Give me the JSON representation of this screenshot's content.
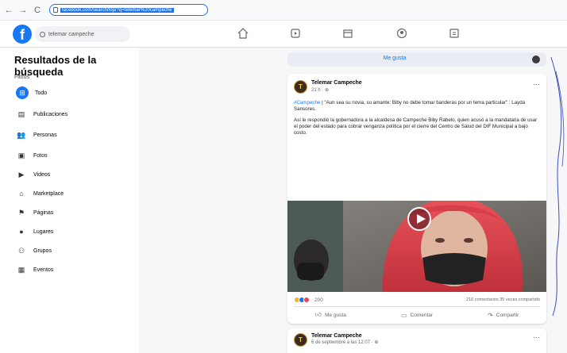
{
  "browser": {
    "url": "facebook.com/search/top/?q=telemar%20campeche"
  },
  "header": {
    "logo": "f",
    "search_value": "telemar campeche"
  },
  "sidebar": {
    "title": "Resultados de la búsqueda",
    "filters_label": "Filtros",
    "items": [
      {
        "label": "Todo",
        "icon": "grid-icon",
        "glyph": "⊞",
        "active": true
      },
      {
        "label": "Publicaciones",
        "icon": "post-icon",
        "glyph": "▤"
      },
      {
        "label": "Personas",
        "icon": "people-icon",
        "glyph": "👥"
      },
      {
        "label": "Fotos",
        "icon": "photo-icon",
        "glyph": "▣"
      },
      {
        "label": "Videos",
        "icon": "video-icon",
        "glyph": "▶"
      },
      {
        "label": "Marketplace",
        "icon": "marketplace-icon",
        "glyph": "⌂"
      },
      {
        "label": "Páginas",
        "icon": "flag-icon",
        "glyph": "⚑"
      },
      {
        "label": "Lugares",
        "icon": "location-icon",
        "glyph": "●"
      },
      {
        "label": "Grupos",
        "icon": "groups-icon",
        "glyph": "⚇"
      },
      {
        "label": "Eventos",
        "icon": "calendar-icon",
        "glyph": "▦"
      }
    ]
  },
  "feed": {
    "page_like_label": "Me gusta",
    "post": {
      "author": "Telemar Campeche",
      "time": "21 h · ⊕",
      "hashtag": "#Campeche",
      "line1": " | \"Aun sea su novia, su amante: Biby no debe tomar banderas por un tema particular\" : Layda Sansores.",
      "line2": "Así le respondió la gobernadora a la alcaldesa de Campeche Biby Rabelo, quien acusó a la mandataria de usar el poder del estado para cobrar venganza política por el cierre del Centro de Salud del DIF Municipal a bajo costo.",
      "reaction_count": "200",
      "stats": "216 comentarios  35 veces compartido",
      "actions": {
        "like": "Me gusta",
        "comment": "Comentar",
        "share": "Compartir"
      }
    },
    "post2": {
      "author": "Telemar Campeche",
      "time": "6 de septiembre a las 12:07 · ⊕"
    }
  },
  "colors": {
    "brand": "#1877f2",
    "background": "#f0f2f5"
  }
}
